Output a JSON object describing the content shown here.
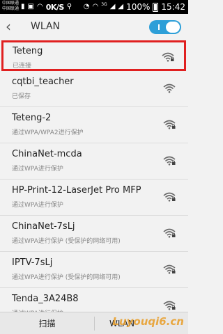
{
  "status_bar": {
    "carrier_line1": "中国联通",
    "carrier_line2": "中国联通",
    "speed": "0K/S",
    "network_type": "3G",
    "battery": "100%",
    "time": "15:42"
  },
  "header": {
    "title": "WLAN",
    "wlan_enabled": true
  },
  "networks": [
    {
      "name": "Teteng",
      "status": "已连接",
      "secured": true,
      "connected": true
    },
    {
      "name": "cqtbi_teacher",
      "status": "已保存",
      "secured": false,
      "connected": false
    },
    {
      "name": "Teteng-2",
      "status": "通过WPA/WPA2进行保护",
      "secured": true,
      "connected": false
    },
    {
      "name": "ChinaNet-mcda",
      "status": "通过WPA进行保护",
      "secured": true,
      "connected": false
    },
    {
      "name": "HP-Print-12-LaserJet Pro MFP",
      "status": "通过WPA进行保护",
      "secured": true,
      "connected": false
    },
    {
      "name": "ChinaNet-7sLj",
      "status": "通过WPA进行保护 (受保护的网络可用)",
      "secured": true,
      "connected": false
    },
    {
      "name": "IPTV-7sLj",
      "status": "通过WPA进行保护 (受保护的网络可用)",
      "secured": true,
      "connected": false
    },
    {
      "name": "Tenda_3A24B8",
      "status": "通过WPA进行保护",
      "secured": true,
      "connected": false
    }
  ],
  "bottom_bar": {
    "scan_label": "扫描",
    "wlan_label": "WLAN",
    "watermark": "Luyouqi6.cn"
  },
  "colors": {
    "accent": "#2d9fd8",
    "highlight_border": "#e02020"
  }
}
